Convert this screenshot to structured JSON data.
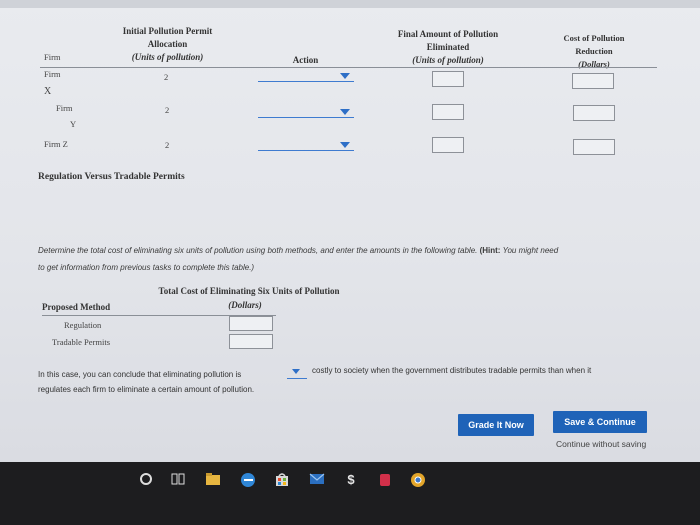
{
  "table1": {
    "headers": {
      "initial_permit": [
        "Initial Pollution Permit",
        "Allocation",
        "(Units of pollution)"
      ],
      "action": "Action",
      "final_amount": [
        "Final Amount of Pollution",
        "Eliminated",
        "(Units of pollution)"
      ],
      "cost": [
        "Cost of Pollution",
        "Reduction",
        "(Dollars)"
      ]
    },
    "firm_header": "Firm",
    "rows": [
      {
        "label_a": "Firm",
        "label_b": "X",
        "permits": "2"
      },
      {
        "label_a": "Firm",
        "label_b": "Y",
        "permits": "2"
      },
      {
        "label_a": "Firm Z",
        "label_b": "",
        "permits": "2"
      }
    ]
  },
  "section_title": "Regulation Versus Tradable Permits",
  "instruction": {
    "line1_pre": "Determine the total cost of eliminating six units of pollution using both methods, and enter the amounts in the following table. ",
    "hint_label": "(Hint:",
    "line1_post": " You might need",
    "line2": "to get information from previous tasks to complete this table.)"
  },
  "table2": {
    "header_top": "Total Cost of Eliminating Six Units of Pollution",
    "header_sub": "(Dollars)",
    "method_header": "Proposed Method",
    "rows": [
      "Regulation",
      "Tradable Permits"
    ]
  },
  "conclusion": {
    "pre": "In this case, you can conclude that eliminating pollution is",
    "post": "costly to society when the government distributes tradable permits than when it",
    "line2": "regulates each firm to eliminate a certain amount of pollution."
  },
  "buttons": {
    "grade": "Grade It Now",
    "save": "Save & Continue",
    "continue_link": "Continue without saving"
  },
  "colors": {
    "accent": "#1f63b8",
    "dropdown": "#2e6fc7"
  },
  "taskbar_icons": [
    "circle-icon",
    "task-view-icon",
    "file-explorer-icon",
    "edge-icon",
    "store-icon",
    "mail-icon",
    "dollar-icon",
    "app-icon",
    "chrome-icon"
  ]
}
